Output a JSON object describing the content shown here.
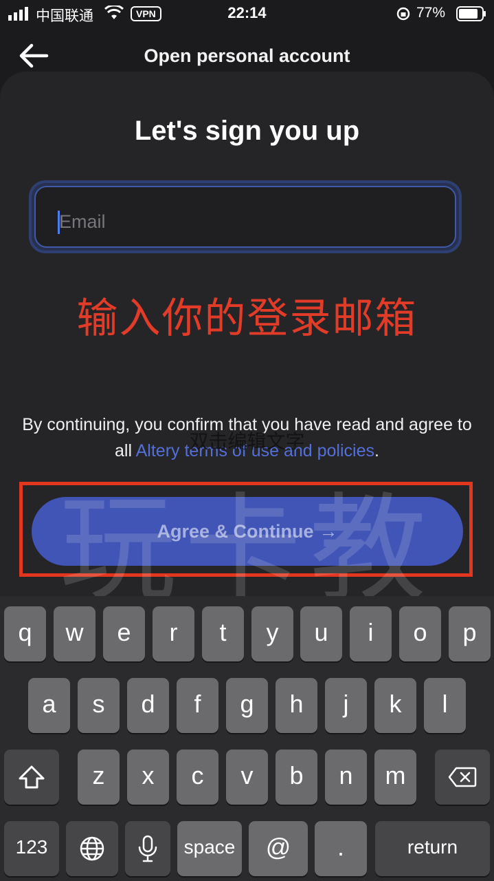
{
  "status_bar": {
    "carrier": "中国联通",
    "vpn": "VPN",
    "time": "22:14",
    "battery": "77%"
  },
  "nav": {
    "title": "Open personal account",
    "back_icon": "arrow-left-icon"
  },
  "signup": {
    "heading": "Let's sign you up",
    "email_placeholder": "Email",
    "email_value": "",
    "annotation": "输入你的登录邮箱",
    "consent_prefix": "By continuing, you confirm that you have read and agree to all ",
    "consent_link": "Altery terms of use and policies",
    "consent_suffix": ".",
    "continue_label": "Agree & Continue",
    "continue_arrow": "→"
  },
  "watermark": {
    "small": "双击编辑文字",
    "big": "玩卡教授"
  },
  "keyboard": {
    "row1": [
      "q",
      "w",
      "e",
      "r",
      "t",
      "y",
      "u",
      "i",
      "o",
      "p"
    ],
    "row2": [
      "a",
      "s",
      "d",
      "f",
      "g",
      "h",
      "j",
      "k",
      "l"
    ],
    "row3": [
      "z",
      "x",
      "c",
      "v",
      "b",
      "n",
      "m"
    ],
    "bottom": {
      "numbers": "123",
      "space": "space",
      "at": "@",
      "dot": ".",
      "return": "return"
    }
  },
  "colors": {
    "background": "#1b1b1d",
    "sheet": "#252528",
    "accent": "#4155b6",
    "link": "#5470d8",
    "annotation_red": "#e23b28"
  }
}
